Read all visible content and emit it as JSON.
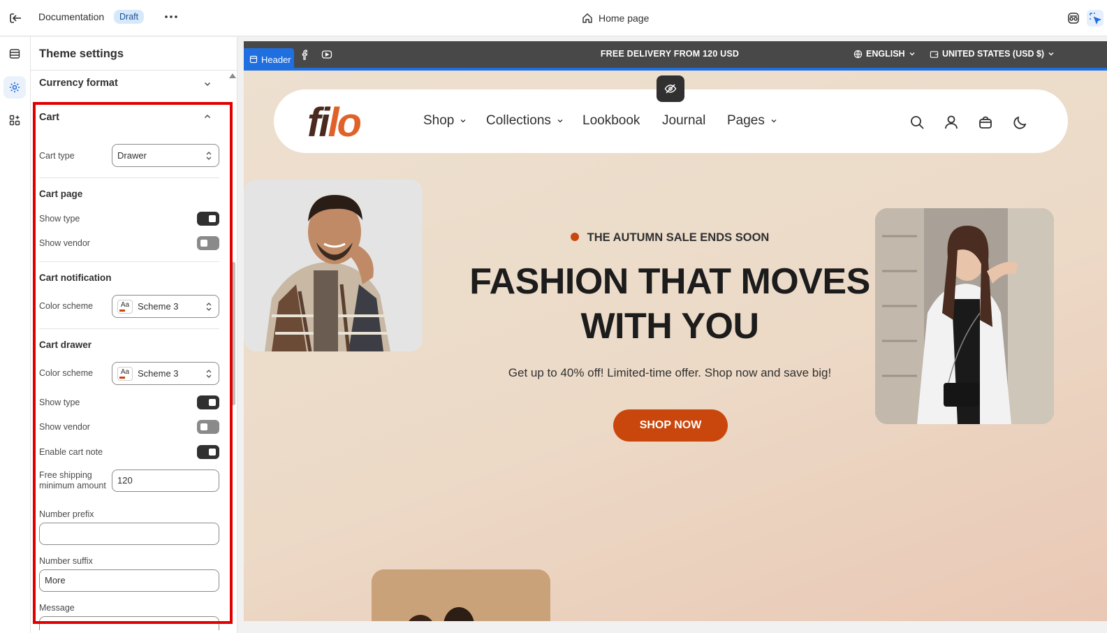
{
  "topbar": {
    "exit_icon": "exit-icon",
    "doc_title": "Documentation",
    "status_badge": "Draft",
    "more_icon": "more-horizontal-icon",
    "page_select": "Home page",
    "home_icon": "home-icon",
    "right_icons": [
      "incognito-icon",
      "select-cursor-icon"
    ]
  },
  "rail": {
    "items": [
      {
        "icon": "sections-icon",
        "active": false
      },
      {
        "icon": "settings-gear-icon",
        "active": true
      },
      {
        "icon": "apps-icon",
        "active": false
      }
    ]
  },
  "panel": {
    "title": "Theme settings",
    "currency_format": "Currency format",
    "cart": {
      "heading": "Cart",
      "cart_type_label": "Cart type",
      "cart_type_value": "Drawer",
      "cart_page": {
        "heading": "Cart page",
        "show_type_label": "Show type",
        "show_type": true,
        "show_vendor_label": "Show vendor",
        "show_vendor": false
      },
      "cart_notification": {
        "heading": "Cart notification",
        "color_scheme_label": "Color scheme",
        "color_scheme_value": "Scheme 3",
        "swatch_text": "Aa"
      },
      "cart_drawer": {
        "heading": "Cart drawer",
        "color_scheme_label": "Color scheme",
        "color_scheme_value": "Scheme 3",
        "swatch_text": "Aa",
        "show_type_label": "Show type",
        "show_type": true,
        "show_vendor_label": "Show vendor",
        "show_vendor": false,
        "cart_note_label": "Enable cart note",
        "cart_note": true,
        "free_shipping_label": "Free shipping minimum amount",
        "free_shipping_value": "120",
        "number_prefix_label": "Number prefix",
        "number_prefix_value": "",
        "number_suffix_label": "Number suffix",
        "number_suffix_value": "More",
        "message_label": "Message"
      }
    }
  },
  "preview": {
    "header_tag": "Header",
    "announcement": "FREE DELIVERY FROM 120 USD",
    "language": "ENGLISH",
    "currency": "UNITED STATES (USD $)",
    "logo_part1": "fi",
    "logo_part2": "lo",
    "nav": [
      "Shop",
      "Collections",
      "Lookbook",
      "Journal",
      "Pages"
    ],
    "nav_icons": [
      "search-icon",
      "account-icon",
      "cart-bag-icon",
      "dark-mode-moon-icon"
    ],
    "sale_label": "THE AUTUMN SALE ENDS SOON",
    "headline_line1": "FASHION THAT MOVES",
    "headline_line2": "WITH YOU",
    "subline": "Get up to 40% off! Limited-time offer. Shop now and save big!",
    "cta": "SHOP NOW",
    "colors": {
      "accent": "#c9470d",
      "logo_dark": "#4a2a1e",
      "logo_orange": "#e0622a",
      "selection": "#1f6fe0",
      "frame": "#e00000"
    }
  }
}
